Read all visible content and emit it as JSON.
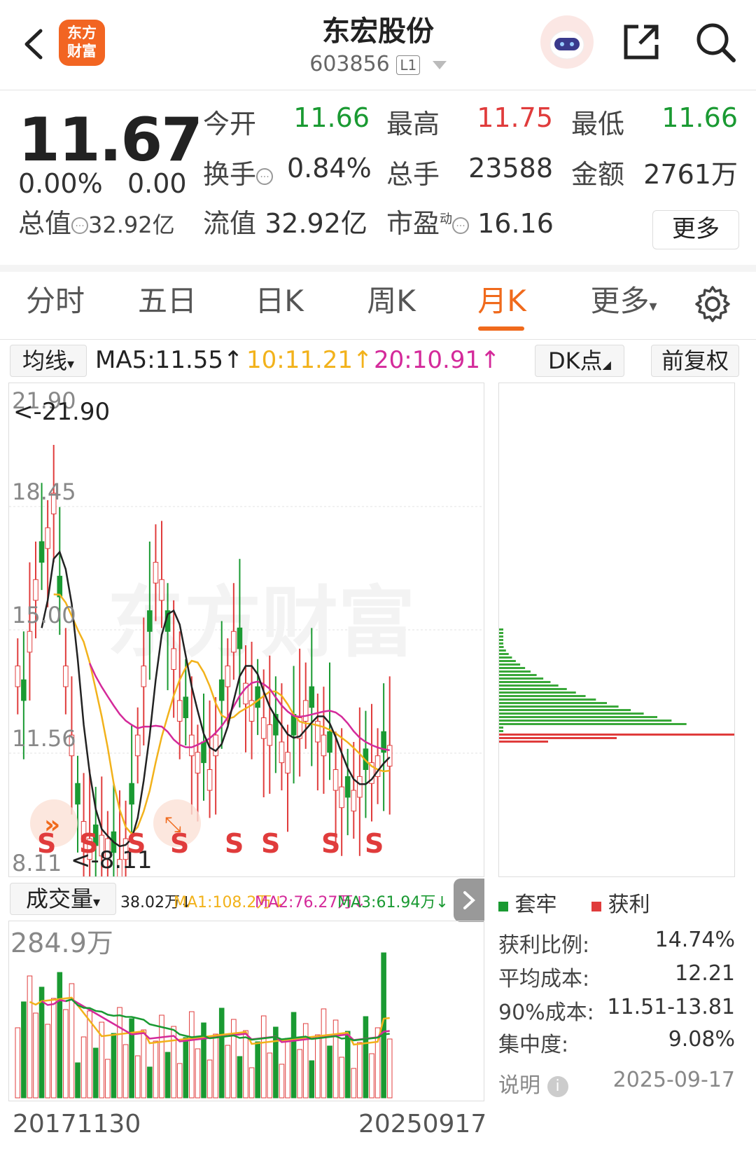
{
  "header": {
    "title": "东宏股份",
    "code": "603856",
    "level": "L1",
    "logo_text": "东方\n财富"
  },
  "quote": {
    "price": "11.67",
    "change_pct": "0.00%",
    "change": "0.00",
    "open_label": "今开",
    "open": "11.66",
    "high_label": "最高",
    "high": "11.75",
    "low_label": "最低",
    "low": "11.66",
    "turnover_label": "换手",
    "turnover": "0.84%",
    "volume_label": "总手",
    "volume": "23588",
    "amount_label": "金额",
    "amount": "2761万",
    "total_mv_label": "总值",
    "total_mv": "32.92亿",
    "float_mv_label": "流值",
    "float_mv": "32.92亿",
    "pe_label": "市盈",
    "pe_sup": "动",
    "pe": "16.16",
    "more_label": "更多"
  },
  "tabs": [
    {
      "label": "分时"
    },
    {
      "label": "五日"
    },
    {
      "label": "日K"
    },
    {
      "label": "周K"
    },
    {
      "label": "月K",
      "active": true
    },
    {
      "label": "更多"
    }
  ],
  "ma": {
    "selector": "均线",
    "ma5": "MA5:11.55↑",
    "ma10": "10:11.21↑",
    "ma20": "20:10.91↑",
    "dk": "DK点",
    "adjust": "前复权"
  },
  "price_chart": {
    "y_labels": [
      "21.90",
      "18.45",
      "15.00",
      "11.56",
      "8.11"
    ],
    "max_tag": "<-21.90",
    "min_tag": "<-8.11",
    "signal": "S"
  },
  "volume": {
    "selector": "成交量",
    "vol": "38.02万↓",
    "ma1": "MA1:108.2万↓",
    "ma2": "MA2:76.27万↓",
    "ma3": "MA3:61.94万↓",
    "max": "284.9万"
  },
  "dates": {
    "start": "20171130",
    "end": "20250917"
  },
  "chip": {
    "legend_trapped": "套牢",
    "legend_profit": "获利",
    "stats": [
      {
        "label": "获利比例:",
        "value": "14.74%"
      },
      {
        "label": "平均成本:",
        "value": "12.21"
      },
      {
        "label": "90%成本:",
        "value": "11.51-13.81"
      },
      {
        "label": "集中度:",
        "value": "9.08%"
      }
    ],
    "note_label": "说明",
    "date": "2025-09-17"
  },
  "colors": {
    "up": "#e03c3c",
    "down": "#1a9a32",
    "accent": "#f06a1c",
    "ma5": "#222222",
    "ma10": "#f2b21b",
    "ma20": "#d42a9a"
  }
}
